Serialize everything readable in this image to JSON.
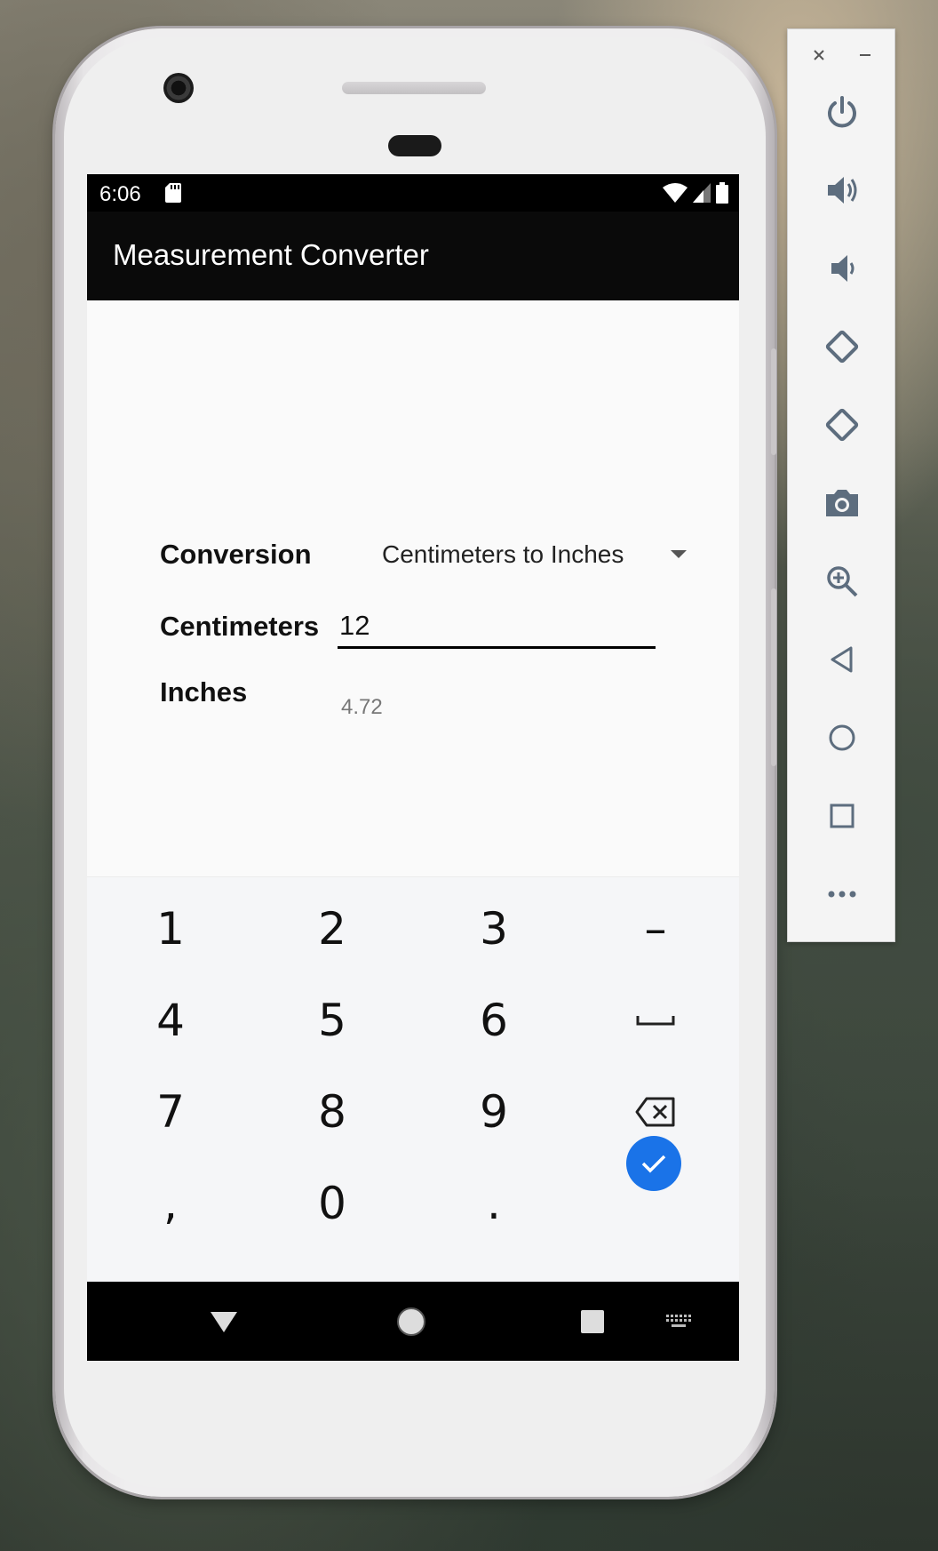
{
  "status_bar": {
    "time": "6:06"
  },
  "app": {
    "title": "Measurement Converter"
  },
  "form": {
    "conversion_label": "Conversion",
    "conversion_value": "Centimeters to Inches",
    "input_label": "Centimeters",
    "input_value": "12",
    "output_label": "Inches",
    "output_value": "4.72"
  },
  "keyboard": {
    "keys": [
      "1",
      "2",
      "3",
      "–",
      "4",
      "5",
      "6",
      "␣",
      "7",
      "8",
      "9",
      "backspace",
      ",",
      "0",
      ".",
      "done"
    ]
  },
  "colors": {
    "accent": "#1a73e8",
    "app_bar": "#0a0a0a",
    "status_bar": "#000000"
  },
  "icons": {
    "status": [
      "sd-card-icon",
      "wifi-icon",
      "signal-icon",
      "battery-icon"
    ],
    "nav": [
      "back-icon",
      "home-icon",
      "recents-icon",
      "keyboard-icon"
    ],
    "toolbar": [
      "close-icon",
      "minimize-icon",
      "power-icon",
      "volume-up-icon",
      "volume-down-icon",
      "rotate-left-icon",
      "rotate-right-icon",
      "camera-icon",
      "zoom-icon",
      "back-icon",
      "home-icon",
      "overview-icon",
      "more-icon"
    ]
  }
}
